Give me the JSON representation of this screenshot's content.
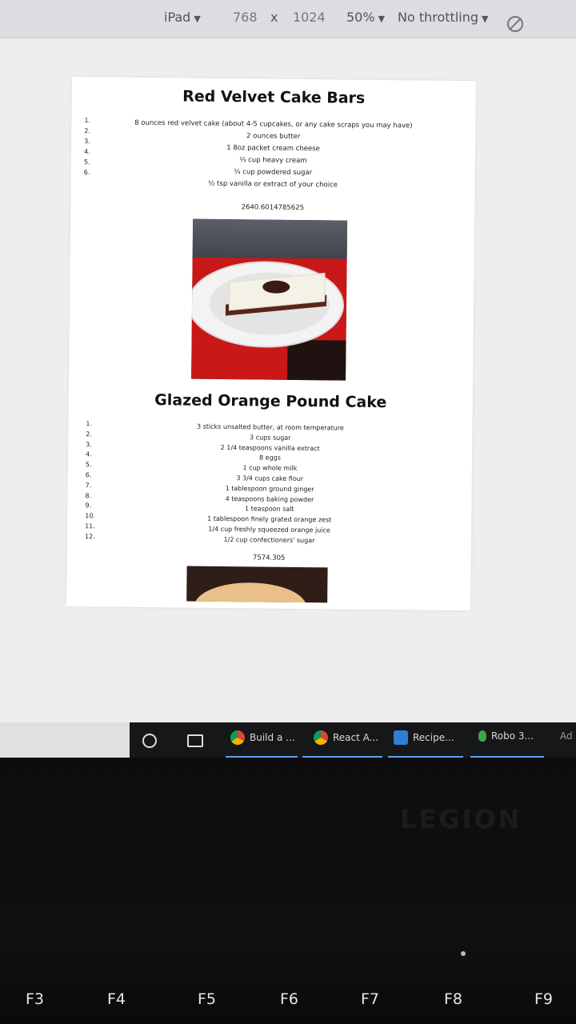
{
  "devtools": {
    "device": "iPad",
    "width": "768",
    "times": "x",
    "height": "1024",
    "zoom": "50%",
    "throttling": "No throttling",
    "caret": "▼"
  },
  "recipes": [
    {
      "title": "Red Velvet Cake Bars",
      "numbers": [
        "1.",
        "2.",
        "3.",
        "4.",
        "5.",
        "6."
      ],
      "ingredients": [
        "8 ounces red velvet cake (about 4-5 cupcakes, or any cake scraps you may have)",
        "2 ounces butter",
        "1 8oz packet cream cheese",
        "⅓ cup heavy cream",
        "¼ cup powdered sugar",
        "½ tsp vanilla or extract of your choice"
      ],
      "value": "2640.6014785625"
    },
    {
      "title": "Glazed Orange Pound Cake",
      "numbers": [
        "1.",
        "2.",
        "3.",
        "4.",
        "5.",
        "6.",
        "7.",
        "8.",
        "9.",
        "10.",
        "11.",
        "12."
      ],
      "ingredients": [
        "3 sticks unsalted butter, at room temperature",
        "3 cups sugar",
        "2 1/4 teaspoons vanilla extract",
        "8 eggs",
        "1 cup whole milk",
        "3 3/4 cups cake flour",
        "1 tablespoon ground ginger",
        "4 teaspoons baking powder",
        "1 teaspoon salt",
        "1 tablespoon finely grated orange zest",
        "1/4 cup freshly squeezed orange juice",
        "1/2 cup confectioners' sugar"
      ],
      "value": "7574.305"
    }
  ],
  "taskbar": {
    "apps": [
      {
        "label": "Build a ...",
        "icon": "chrome-icon"
      },
      {
        "label": "React A...",
        "icon": "chrome-icon"
      },
      {
        "label": "Recipe...",
        "icon": "vscode-icon"
      },
      {
        "label": "Robo 3...",
        "icon": "robo3t-icon"
      },
      {
        "label": "Ad",
        "icon": ""
      }
    ]
  },
  "keyboard": {
    "brand": "LEGION",
    "fkeys": [
      "F3",
      "F4",
      "F5",
      "F6",
      "F7",
      "F8",
      "F9"
    ]
  }
}
